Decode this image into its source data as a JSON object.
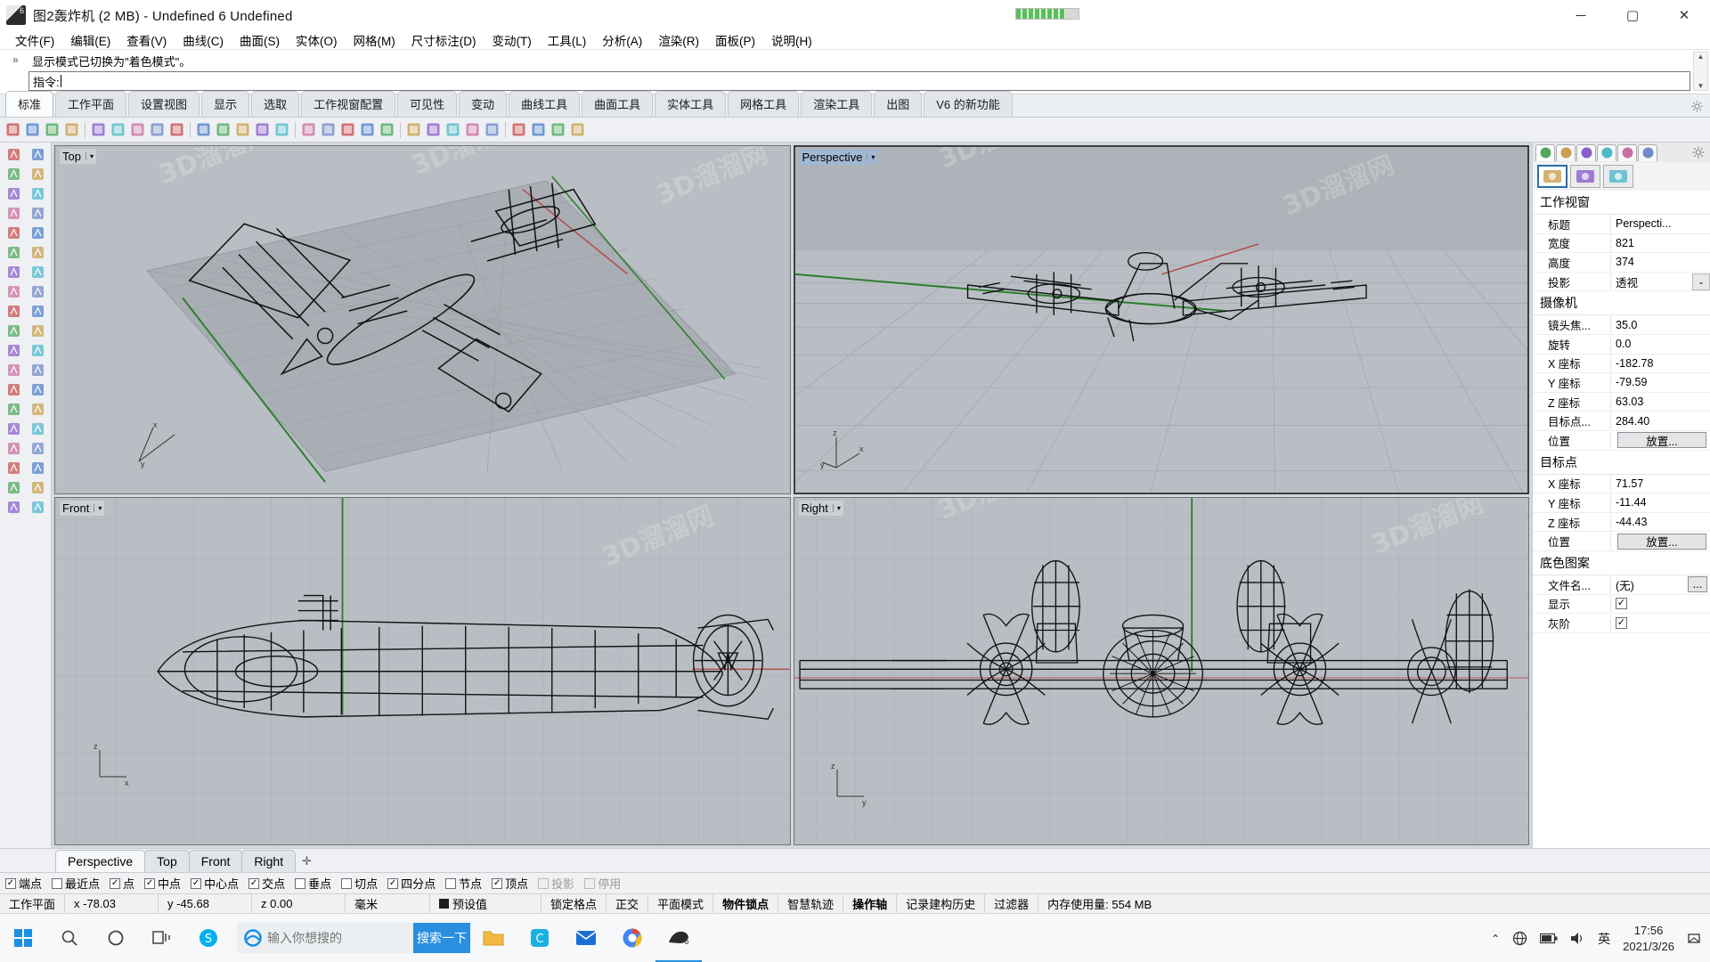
{
  "titlebar": {
    "title": "图2轰炸机 (2 MB) - Undefined 6 Undefined",
    "minimize": "－",
    "maximize": "▢",
    "close": "✕"
  },
  "menubar": {
    "items": [
      {
        "label": "文件(F)"
      },
      {
        "label": "编辑(E)"
      },
      {
        "label": "查看(V)"
      },
      {
        "label": "曲线(C)"
      },
      {
        "label": "曲面(S)"
      },
      {
        "label": "实体(O)"
      },
      {
        "label": "网格(M)"
      },
      {
        "label": "尺寸标注(D)"
      },
      {
        "label": "变动(T)"
      },
      {
        "label": "工具(L)"
      },
      {
        "label": "分析(A)"
      },
      {
        "label": "渲染(R)"
      },
      {
        "label": "面板(P)"
      },
      {
        "label": "说明(H)"
      }
    ]
  },
  "command": {
    "chevron": "»",
    "history": "显示模式已切换为\"着色模式\"。",
    "prompt_label": "指令:",
    "input_value": "",
    "scroll_up": "▲",
    "scroll_down": "▼"
  },
  "ribbon": {
    "tabs": [
      {
        "label": "标准",
        "active": true
      },
      {
        "label": "工作平面"
      },
      {
        "label": "设置视图"
      },
      {
        "label": "显示"
      },
      {
        "label": "选取"
      },
      {
        "label": "工作视窗配置"
      },
      {
        "label": "可见性"
      },
      {
        "label": "变动"
      },
      {
        "label": "曲线工具"
      },
      {
        "label": "曲面工具"
      },
      {
        "label": "实体工具"
      },
      {
        "label": "网格工具"
      },
      {
        "label": "渲染工具"
      },
      {
        "label": "出图"
      },
      {
        "label": "V6 的新功能"
      }
    ],
    "options_icon": "gear-icon"
  },
  "toolbar": {
    "items": [
      "new-file-icon",
      "open-file-icon",
      "save-icon",
      "print-icon",
      "cut-icon",
      "copy-icon",
      "paste-icon",
      "undo-icon",
      "redo-icon",
      "select-icon",
      "pan-icon",
      "zoom-window-icon",
      "zoom-extents-icon",
      "zoom-selected-icon",
      "grid-snap-icon",
      "layers-icon",
      "viewport-split-icon",
      "hide-objects-icon",
      "show-objects-icon",
      "lock-objects-icon",
      "color-wheel-icon",
      "material-icon",
      "light-icon",
      "render-icon",
      "group-icon",
      "explode-icon",
      "earth-icon",
      "link-icon"
    ]
  },
  "leftbar": {
    "items": [
      "select-arrow-icon",
      "select-points-icon",
      "polyline-icon",
      "line-icon",
      "circle-icon",
      "arc-icon",
      "curve-icon",
      "rectangle-icon",
      "ellipse-icon",
      "freeform-icon",
      "surface-icon",
      "loft-icon",
      "revolve-icon",
      "sweep-icon",
      "box-solid-icon",
      "sphere-icon",
      "cylinder-icon",
      "boolean-icon",
      "transform-icon",
      "explode2-icon",
      "fillet-icon",
      "trim-icon",
      "split-icon",
      "offset-icon",
      "array-icon",
      "mirror-icon",
      "scale-icon",
      "rotate-icon",
      "text-icon",
      "dimension-icon",
      "hatch-icon",
      "grid-icon",
      "analysis-icon",
      "measure-icon",
      "section-icon",
      "check-icon",
      "render2-icon",
      "apply-icon"
    ]
  },
  "viewports": [
    {
      "name": "Top",
      "active": false,
      "arrow": "▾"
    },
    {
      "name": "Perspective",
      "active": true,
      "arrow": "▾"
    },
    {
      "name": "Front",
      "active": false,
      "arrow": "▾"
    },
    {
      "name": "Right",
      "active": false,
      "arrow": "▾"
    }
  ],
  "right_panel": {
    "tabs": [
      "properties-color-icon",
      "layers-icon",
      "material-sphere-icon",
      "brush-icon",
      "folder-icon",
      "help-icon"
    ],
    "gear": "gear-icon",
    "subtabs": [
      "camera-icon",
      "viewport-frame-icon",
      "chain-icon"
    ],
    "groups": [
      {
        "title": "工作视窗",
        "rows": [
          {
            "key": "标题",
            "value": "Perspecti...",
            "type": "text"
          },
          {
            "key": "宽度",
            "value": "821",
            "type": "text"
          },
          {
            "key": "高度",
            "value": "374",
            "type": "text"
          },
          {
            "key": "投影",
            "value": "透视",
            "type": "combo",
            "combo": "⌄"
          }
        ]
      },
      {
        "title": "摄像机",
        "rows": [
          {
            "key": "镜头焦...",
            "value": "35.0",
            "type": "text"
          },
          {
            "key": "旋转",
            "value": "0.0",
            "type": "text"
          },
          {
            "key": "X 座标",
            "value": "-182.78",
            "type": "text"
          },
          {
            "key": "Y 座标",
            "value": "-79.59",
            "type": "text"
          },
          {
            "key": "Z 座标",
            "value": "63.03",
            "type": "text"
          },
          {
            "key": "目标点...",
            "value": "284.40",
            "type": "text"
          },
          {
            "key": "位置",
            "value": "放置...",
            "type": "button"
          }
        ]
      },
      {
        "title": "目标点",
        "rows": [
          {
            "key": "X 座标",
            "value": "71.57",
            "type": "text"
          },
          {
            "key": "Y 座标",
            "value": "-11.44",
            "type": "text"
          },
          {
            "key": "Z 座标",
            "value": "-44.43",
            "type": "text"
          },
          {
            "key": "位置",
            "value": "放置...",
            "type": "button"
          }
        ]
      },
      {
        "title": "底色图案",
        "rows": [
          {
            "key": "文件名...",
            "value": "(无)",
            "type": "dots",
            "dots": "..."
          },
          {
            "key": "显示",
            "value": "✓",
            "type": "check"
          },
          {
            "key": "灰阶",
            "value": "✓",
            "type": "check"
          }
        ]
      }
    ]
  },
  "viewport_tabs": {
    "items": [
      {
        "label": "Perspective",
        "active": true
      },
      {
        "label": "Top",
        "active": false
      },
      {
        "label": "Front",
        "active": false
      },
      {
        "label": "Right",
        "active": false
      }
    ],
    "add": "✛"
  },
  "osnap": {
    "items": [
      {
        "label": "端点",
        "checked": true,
        "disabled": false
      },
      {
        "label": "最近点",
        "checked": false,
        "disabled": false
      },
      {
        "label": "点",
        "checked": true,
        "disabled": false
      },
      {
        "label": "中点",
        "checked": true,
        "disabled": false
      },
      {
        "label": "中心点",
        "checked": true,
        "disabled": false
      },
      {
        "label": "交点",
        "checked": true,
        "disabled": false
      },
      {
        "label": "垂点",
        "checked": false,
        "disabled": false
      },
      {
        "label": "切点",
        "checked": false,
        "disabled": false
      },
      {
        "label": "四分点",
        "checked": true,
        "disabled": false
      },
      {
        "label": "节点",
        "checked": false,
        "disabled": false
      },
      {
        "label": "顶点",
        "checked": true,
        "disabled": false
      },
      {
        "label": "投影",
        "checked": false,
        "disabled": true
      },
      {
        "label": "停用",
        "checked": false,
        "disabled": true
      }
    ]
  },
  "statusbar": {
    "cplane": "工作平面",
    "x": "x -78.03",
    "y": "y -45.68",
    "z": "z 0.00",
    "units": "毫米",
    "layer": "预设值",
    "layer_color": "#1d1d1d",
    "toggles": [
      {
        "label": "锁定格点",
        "bold": false
      },
      {
        "label": "正交",
        "bold": false
      },
      {
        "label": "平面模式",
        "bold": false
      },
      {
        "label": "物件锁点",
        "bold": true
      },
      {
        "label": "智慧轨迹",
        "bold": false
      },
      {
        "label": "操作轴",
        "bold": true
      },
      {
        "label": "记录建构历史",
        "bold": false
      },
      {
        "label": "过滤器",
        "bold": false
      }
    ],
    "memory": "内存使用量: 554 MB"
  },
  "taskbar": {
    "start": "start-icon",
    "search": "search-icon",
    "cortana": "cortana-circle-icon",
    "taskview": "task-view-icon",
    "skype": "skype-icon",
    "search_box": {
      "icon": "ie-icon",
      "placeholder": "输入你想搜的",
      "value": "",
      "button": "搜索一下",
      "button_color": "#2a8fe0"
    },
    "pinned": [
      "file-explorer-icon",
      "browser-c-icon",
      "mail-icon",
      "chrome-icon",
      "rhino6-icon"
    ],
    "tray": [
      "chevron-up-icon",
      "network-icon",
      "battery-icon",
      "volume-icon"
    ],
    "ime": "英",
    "time": "17:56",
    "date": "2021/3/26",
    "notification": "notification-icon"
  }
}
